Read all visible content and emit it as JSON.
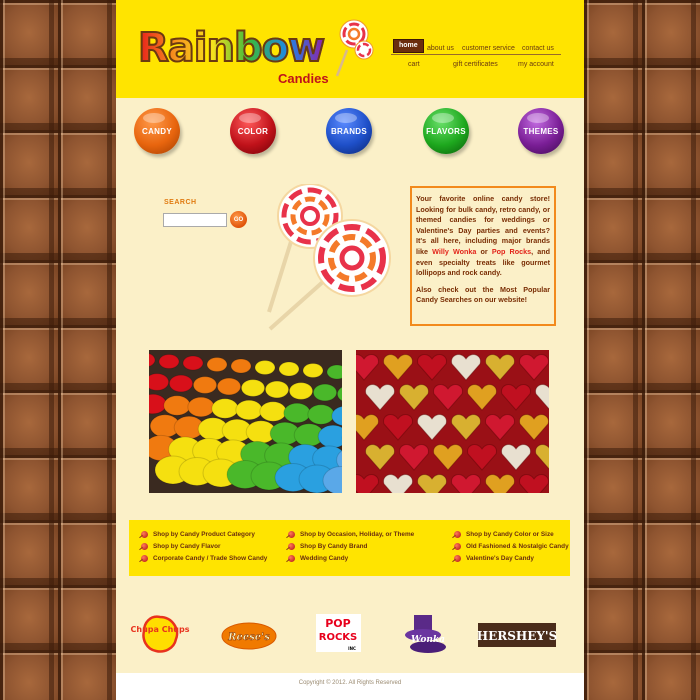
{
  "logo": {
    "word": "Rainbow",
    "subtitle": "Candies"
  },
  "nav": {
    "top": [
      "home",
      "about us",
      "customer service",
      "contact us"
    ],
    "bottom": [
      "cart",
      "gift certificates",
      "my account"
    ]
  },
  "categories": [
    {
      "label": "CANDY",
      "color": "#e8650e"
    },
    {
      "label": "COLOR",
      "color": "#c0121a"
    },
    {
      "label": "BRANDS",
      "color": "#1e4fc8"
    },
    {
      "label": "FLAVORS",
      "color": "#1ea81e"
    },
    {
      "label": "THEMES",
      "color": "#7a1e96"
    }
  ],
  "search": {
    "label": "SEARCH",
    "value": "",
    "button": "GO"
  },
  "promo": {
    "p1_a": "Your favorite online candy store! Looking for bulk candy, retro candy, or themed candies for weddings or Valentine's Day parties and events? It's all here, including major brands like",
    "brand1": "Willy Wonka",
    "p1_or": "or",
    "brand2": "Pop Rocks",
    "p1_b": ", and even specialty treats like gourmet lollipops and rock candy.",
    "p2": "Also check out the Most Popular Candy Searches on our website!"
  },
  "links": {
    "col1": [
      "Shop by Candy Product Category",
      "Shop by Candy Flavor",
      "Corporate Candy / Trade Show Candy"
    ],
    "col2": [
      "Shop by Occasion, Holiday, or Theme",
      "Shop By Candy Brand",
      "Wedding Candy"
    ],
    "col3": [
      "Shop by Candy Color or Size",
      "Old Fashioned & Nostalgic Candy",
      "Valentine's Day Candy"
    ]
  },
  "brands": {
    "chupa": "Chupa Chups",
    "reeses": "Reese's",
    "poprocks_a": "POP",
    "poprocks_b": "ROCKS",
    "poprocks_c": "INC",
    "wonka": "Wonka",
    "hersheys": "HERSHEY'S"
  },
  "copyright": "Copyright © 2012. All Rights Reserved"
}
